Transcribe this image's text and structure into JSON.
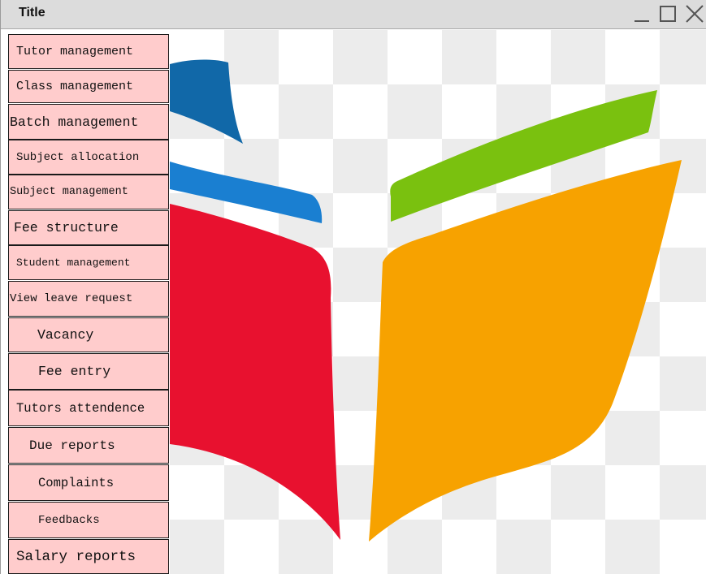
{
  "window": {
    "title": "Title",
    "controls": [
      "minimize-icon",
      "maximize-icon",
      "close-icon"
    ]
  },
  "sidebar": {
    "items": [
      {
        "label": "Tutor management"
      },
      {
        "label": "Class management"
      },
      {
        "label": "Batch management"
      },
      {
        "label": "Subject allocation"
      },
      {
        "label": "Subject management"
      },
      {
        "label": "Fee structure"
      },
      {
        "label": "Student management"
      },
      {
        "label": "View leave request"
      },
      {
        "label": "Vacancy"
      },
      {
        "label": "Fee entry"
      },
      {
        "label": "Tutors attendence"
      },
      {
        "label": "Due reports"
      },
      {
        "label": "Complaints"
      },
      {
        "label": "Feedbacks"
      },
      {
        "label": "Salary reports"
      }
    ],
    "button_color": "#ffcccc"
  },
  "logo": {
    "icon": "open-book-logo",
    "colors": {
      "dark_blue": "#1168a8",
      "blue": "#1a7fd1",
      "red": "#e8112f",
      "green": "#7ac10f",
      "orange": "#f7a200"
    }
  }
}
